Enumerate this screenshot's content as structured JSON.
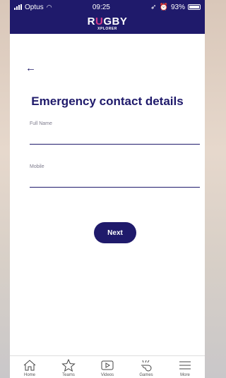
{
  "status_bar": {
    "carrier": "Optus",
    "time": "09:25",
    "battery": "93%"
  },
  "header": {
    "logo_part1": "R",
    "logo_accent": "U",
    "logo_part2": "GBY",
    "logo_sub": "XPLORER"
  },
  "page": {
    "title": "Emergency contact details"
  },
  "form": {
    "full_name_label": "Full Name",
    "full_name_value": "",
    "mobile_label": "Mobile",
    "mobile_value": "",
    "next_label": "Next"
  },
  "tabbar": {
    "items": [
      {
        "label": "Home",
        "icon": "home-icon"
      },
      {
        "label": "Teams",
        "icon": "star-icon"
      },
      {
        "label": "Videos",
        "icon": "video-icon"
      },
      {
        "label": "Games",
        "icon": "whistle-icon"
      },
      {
        "label": "More",
        "icon": "menu-icon"
      }
    ]
  },
  "colors": {
    "brand": "#1f1a6b",
    "accent": "#d23b8d"
  }
}
